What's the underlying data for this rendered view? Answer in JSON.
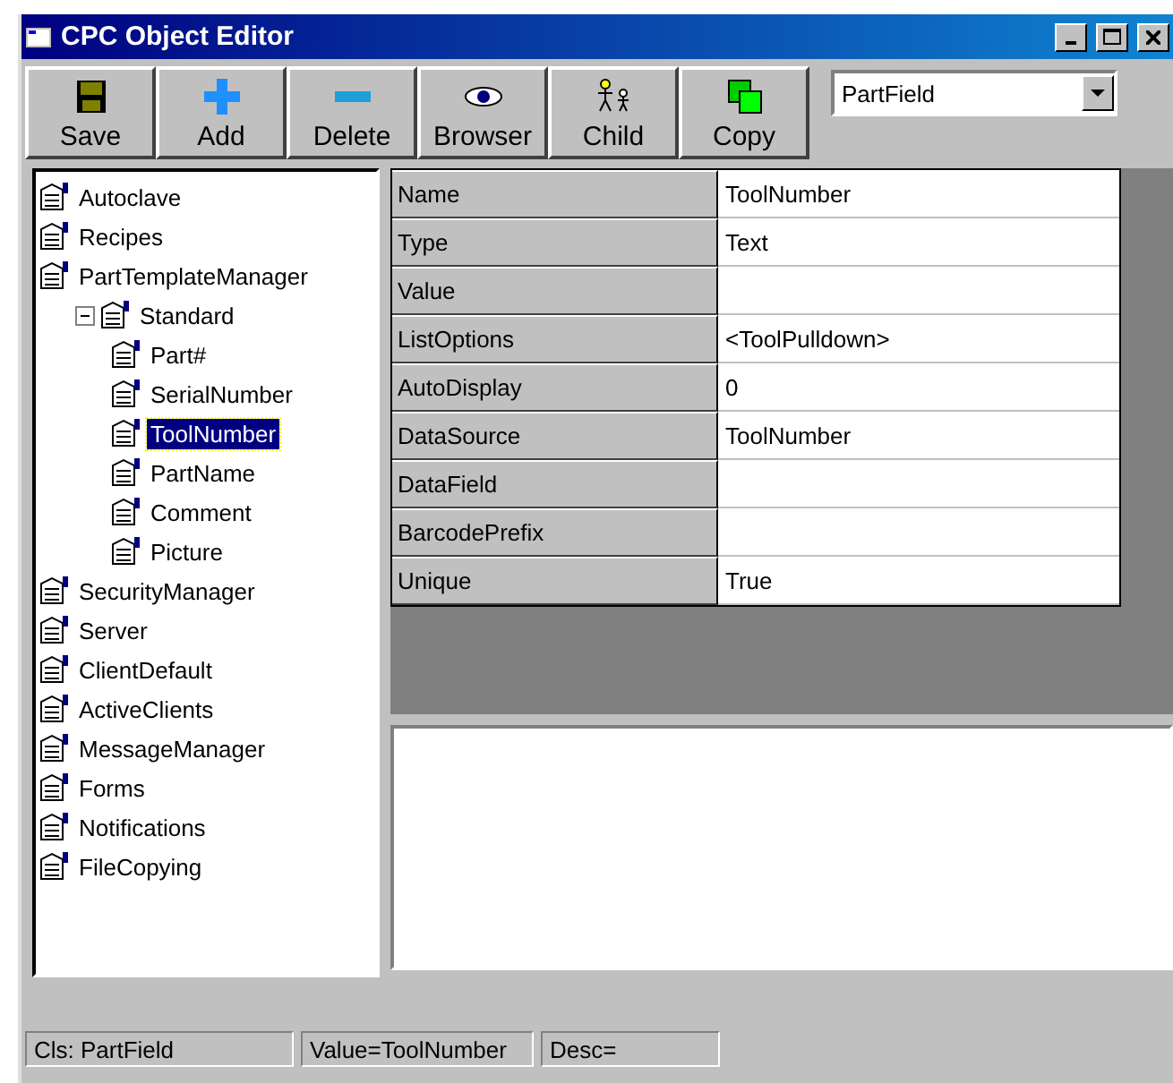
{
  "window": {
    "title": "CPC Object Editor"
  },
  "toolbar": {
    "buttons": [
      {
        "label": "Save",
        "kind": "save"
      },
      {
        "label": "Add",
        "kind": "add"
      },
      {
        "label": "Delete",
        "kind": "delete"
      },
      {
        "label": "Browser",
        "kind": "browser"
      },
      {
        "label": "Child",
        "kind": "child"
      },
      {
        "label": "Copy",
        "kind": "copy"
      }
    ],
    "class_dropdown": {
      "value": "PartField"
    }
  },
  "tree": [
    {
      "label": "Autoclave",
      "selected": false
    },
    {
      "label": "Recipes",
      "selected": false
    },
    {
      "label": "PartTemplateManager",
      "selected": false,
      "children": [
        {
          "label": "Standard",
          "selected": false,
          "expanded": true,
          "children": [
            {
              "label": "Part#",
              "selected": false
            },
            {
              "label": "SerialNumber",
              "selected": false
            },
            {
              "label": "ToolNumber",
              "selected": true
            },
            {
              "label": "PartName",
              "selected": false
            },
            {
              "label": "Comment",
              "selected": false
            },
            {
              "label": "Picture",
              "selected": false
            }
          ]
        }
      ]
    },
    {
      "label": "SecurityManager",
      "selected": false
    },
    {
      "label": "Server",
      "selected": false
    },
    {
      "label": "ClientDefault",
      "selected": false
    },
    {
      "label": "ActiveClients",
      "selected": false
    },
    {
      "label": "MessageManager",
      "selected": false
    },
    {
      "label": "Forms",
      "selected": false
    },
    {
      "label": "Notifications",
      "selected": false
    },
    {
      "label": "FileCopying",
      "selected": false
    }
  ],
  "properties": [
    {
      "name": "Name",
      "value": "ToolNumber"
    },
    {
      "name": "Type",
      "value": "Text"
    },
    {
      "name": "Value"
    },
    {
      "name": "ListOptions",
      "value": "<ToolPulldown>"
    },
    {
      "name": "AutoDisplay",
      "value": "0"
    },
    {
      "name": "DataSource",
      "value": "ToolNumber"
    },
    {
      "name": "DataField"
    },
    {
      "name": "BarcodePrefix"
    },
    {
      "name": "Unique",
      "value": "True"
    }
  ],
  "status_bar": [
    "Cls: PartField",
    "Value=ToolNumber",
    "Desc="
  ]
}
